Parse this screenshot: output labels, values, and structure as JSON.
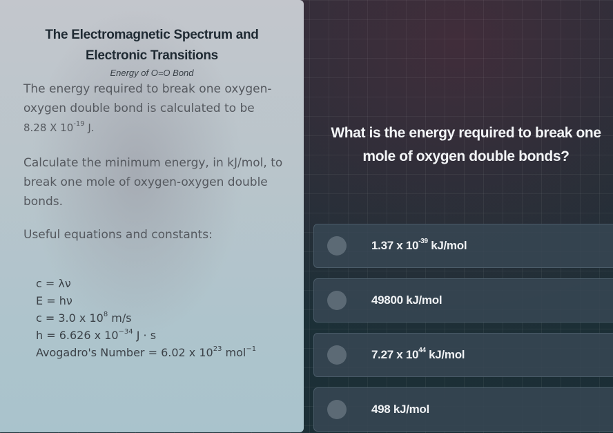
{
  "left_panel": {
    "title_line1": "The Electromagnetic Spectrum and",
    "title_line2": "Electronic Transitions",
    "subtitle": "Energy of O=O Bond",
    "para1_text": "The energy required to break one oxygen-oxygen double bond is calculated to be",
    "para1_value": "8.28 X 10",
    "para1_exp": "-19",
    "para1_unit": " J.",
    "para2": "Calculate the minimum energy, in kJ/mol, to break one mole of oxygen-oxygen double bonds.",
    "para3": "Useful equations and constants:",
    "equations": {
      "eq1": "c = λν",
      "eq2": "E = hν",
      "eq3_base": "c = 3.0 x 10",
      "eq3_exp": "8",
      "eq3_unit": " m/s",
      "eq4_base": "h = 6.626 x 10",
      "eq4_exp": "−34",
      "eq4_unit": " J · s",
      "eq5_base": "Avogadro's Number = 6.02 x 10",
      "eq5_exp": "23",
      "eq5_unit": " mol",
      "eq5_unit_exp": "−1"
    }
  },
  "question": "What is the energy required to break one mole of oxygen double bonds?",
  "options": [
    {
      "base": "1.37 x 10",
      "exp": "-39",
      "unit": " kJ/mol"
    },
    {
      "base": "49800 kJ/mol",
      "exp": "",
      "unit": ""
    },
    {
      "base": "7.27 x 10",
      "exp": "44",
      "unit": " kJ/mol"
    },
    {
      "base": "498 kJ/mol",
      "exp": "",
      "unit": ""
    }
  ]
}
